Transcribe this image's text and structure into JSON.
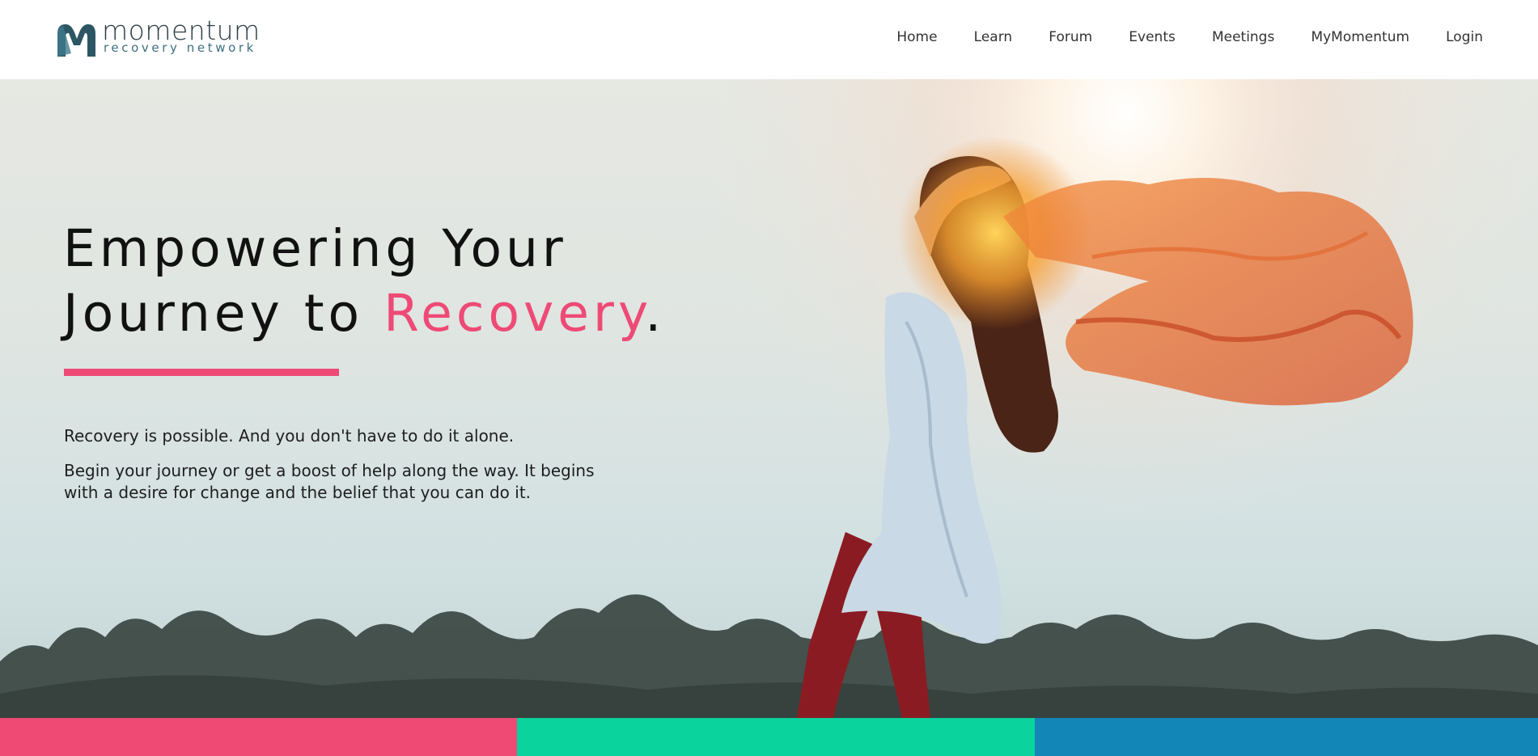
{
  "brand": {
    "name": "momentum",
    "tagline": "recovery network",
    "logo_icon": "m-logo-icon"
  },
  "nav": {
    "items": [
      "Home",
      "Learn",
      "Forum",
      "Events",
      "Meetings",
      "MyMomentum",
      "Login"
    ]
  },
  "hero": {
    "headline_line1": "Empowering Your",
    "headline_line2_prefix": "Journey to ",
    "headline_accent": "Recovery",
    "headline_suffix": ".",
    "paragraph1": "Recovery is possible. And you don't have to do it alone.",
    "paragraph2": "Begin your journey or get a boost of help along the way. It begins with a desire for change and the belief that you can do it.",
    "image": "woman-with-flowing-scarf-at-sunrise"
  },
  "colors": {
    "accent": "#ee4a76",
    "logo_dark": "#2c3e46",
    "logo_teal": "#3d6f80",
    "stripe_pink": "#ef4a74",
    "stripe_green": "#0ad39e",
    "stripe_blue": "#1286b6"
  }
}
